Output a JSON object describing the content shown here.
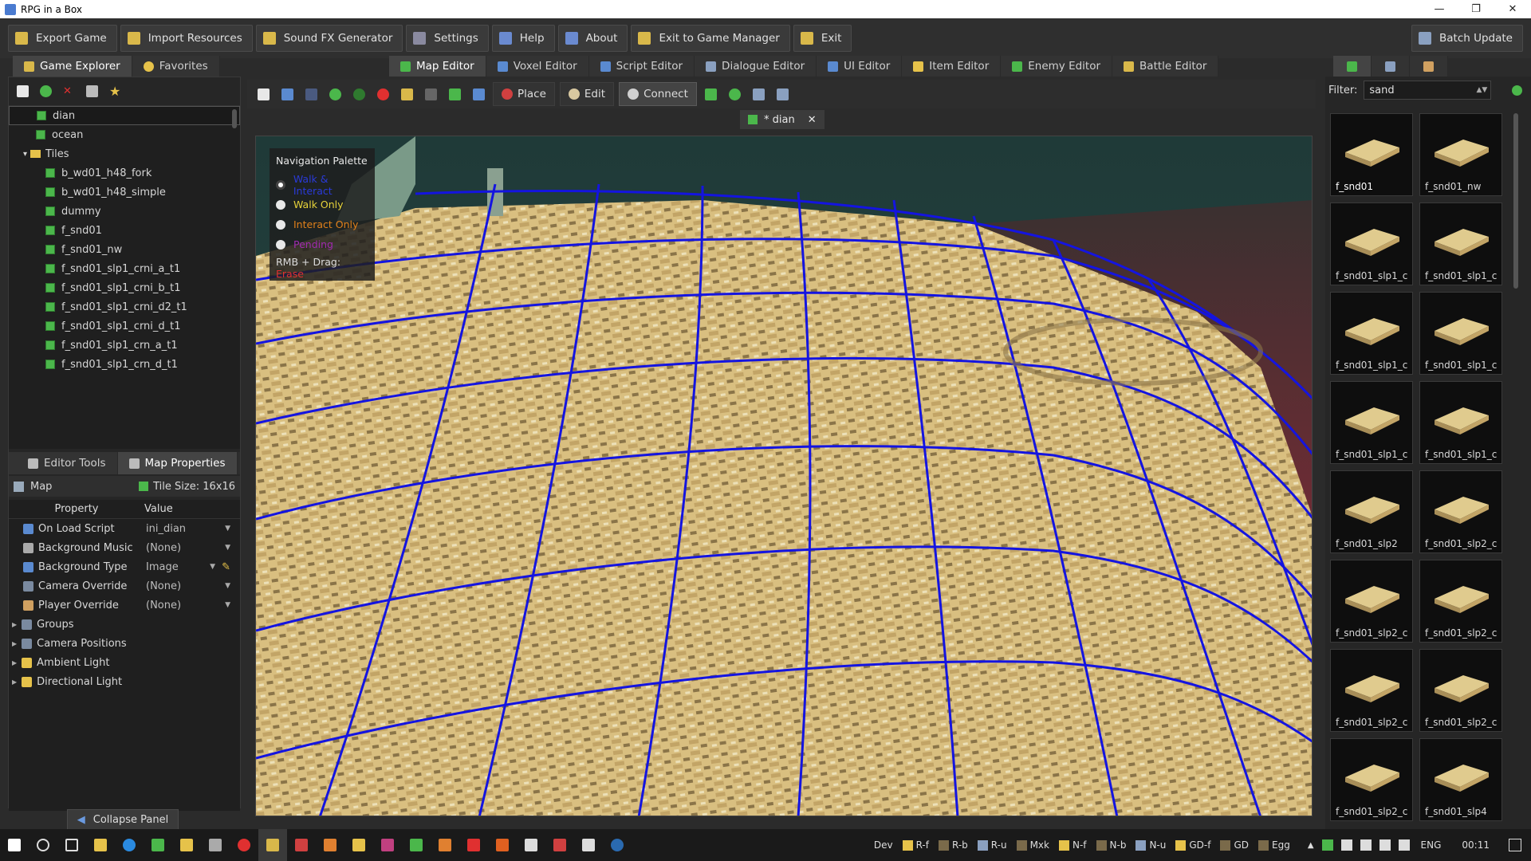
{
  "window": {
    "title": "RPG in a Box"
  },
  "menu": [
    {
      "label": "Export Game",
      "icon": "export-icon",
      "color": "#d9b84a"
    },
    {
      "label": "Import Resources",
      "icon": "import-icon",
      "color": "#d9b84a"
    },
    {
      "label": "Sound FX Generator",
      "icon": "sound-icon",
      "color": "#d9b84a"
    },
    {
      "label": "Settings",
      "icon": "settings-icon",
      "color": "#8a8aa0"
    },
    {
      "label": "Help",
      "icon": "help-icon",
      "color": "#6a8ad0"
    },
    {
      "label": "About",
      "icon": "about-icon",
      "color": "#6a8ad0"
    },
    {
      "label": "Exit to Game Manager",
      "icon": "game-manager-icon",
      "color": "#d9b84a"
    },
    {
      "label": "Exit",
      "icon": "exit-icon",
      "color": "#d9b84a"
    }
  ],
  "batch_update": "Batch Update",
  "left_tabs": [
    "Game Explorer",
    "Favorites"
  ],
  "editor_tabs": [
    "Map Editor",
    "Voxel Editor",
    "Script Editor",
    "Dialogue Editor",
    "UI Editor",
    "Item Editor",
    "Enemy Editor",
    "Battle Editor"
  ],
  "tree": {
    "items": [
      {
        "label": "dian",
        "indent": 34,
        "selected": true
      },
      {
        "label": "ocean",
        "indent": 34
      },
      {
        "label": "Tiles",
        "indent": 18,
        "folder": true
      },
      {
        "label": "b_wd01_h48_fork",
        "indent": 46
      },
      {
        "label": "b_wd01_h48_simple",
        "indent": 46
      },
      {
        "label": "dummy",
        "indent": 46
      },
      {
        "label": "f_snd01",
        "indent": 46
      },
      {
        "label": "f_snd01_nw",
        "indent": 46
      },
      {
        "label": "f_snd01_slp1_crni_a_t1",
        "indent": 46
      },
      {
        "label": "f_snd01_slp1_crni_b_t1",
        "indent": 46
      },
      {
        "label": "f_snd01_slp1_crni_d2_t1",
        "indent": 46
      },
      {
        "label": "f_snd01_slp1_crni_d_t1",
        "indent": 46
      },
      {
        "label": "f_snd01_slp1_crn_a_t1",
        "indent": 46
      },
      {
        "label": "f_snd01_slp1_crn_d_t1",
        "indent": 46
      }
    ]
  },
  "panel_tabs": [
    "Editor Tools",
    "Map Properties"
  ],
  "map_header": {
    "label": "Map",
    "tile_size": "Tile Size: 16x16"
  },
  "props": {
    "col_property": "Property",
    "col_value": "Value",
    "rows": [
      {
        "name": "On Load Script",
        "value": "ini_dian",
        "icon": "#5a8ad0",
        "dropdown": true
      },
      {
        "name": "Background Music",
        "value": "(None)",
        "icon": "#aaaaaa",
        "dropdown": true
      },
      {
        "name": "Background Type",
        "value": "Image",
        "icon": "#5a8ad0",
        "dropdown": true,
        "edit": true
      },
      {
        "name": "Camera Override",
        "value": "(None)",
        "icon": "#7a8aa0",
        "dropdown": true
      },
      {
        "name": "Player Override",
        "value": "(None)",
        "icon": "#d0a060",
        "dropdown": true
      },
      {
        "name": "Groups",
        "value": "",
        "icon": "#7a8aa0",
        "expand": true
      },
      {
        "name": "Camera Positions",
        "value": "",
        "icon": "#7a8aa0",
        "expand": true
      },
      {
        "name": "Ambient Light",
        "value": "",
        "icon": "#e6c24a",
        "expand": true
      },
      {
        "name": "Directional Light",
        "value": "",
        "icon": "#e6c24a",
        "expand": true
      }
    ]
  },
  "collapse_panel": "Collapse Panel",
  "toolbar": {
    "place": "Place",
    "edit": "Edit",
    "connect": "Connect"
  },
  "map_tab": {
    "label": "* dian"
  },
  "nav_palette": {
    "title": "Navigation Palette",
    "options": [
      {
        "label": "Walk & Interact",
        "color": "#2a3ad8",
        "selected": true
      },
      {
        "label": "Walk Only",
        "color": "#e6d23a"
      },
      {
        "label": "Interact Only",
        "color": "#e0801a"
      },
      {
        "label": "Pending",
        "color": "#a02ab0"
      }
    ],
    "rmb": "RMB + Drag:",
    "erase": "Erase"
  },
  "filter": {
    "label": "Filter:",
    "value": "sand"
  },
  "tiles": [
    "f_snd01",
    "f_snd01_nw",
    "f_snd01_slp1_c",
    "f_snd01_slp1_c",
    "f_snd01_slp1_c",
    "f_snd01_slp1_c",
    "f_snd01_slp1_c",
    "f_snd01_slp1_c",
    "f_snd01_slp2",
    "f_snd01_slp2_c",
    "f_snd01_slp2_c",
    "f_snd01_slp2_c",
    "f_snd01_slp2_c",
    "f_snd01_slp2_c",
    "f_snd01_slp2_c",
    "f_snd01_slp4"
  ],
  "taskbar": {
    "items": [
      {
        "label": "Dev",
        "color": ""
      },
      {
        "label": "R-f",
        "color": "#e6c24a"
      },
      {
        "label": "R-b",
        "color": "#7a6a4a"
      },
      {
        "label": "R-u",
        "color": "#8aa0c0"
      },
      {
        "label": "Mxk",
        "color": "#7a6a4a"
      },
      {
        "label": "N-f",
        "color": "#e6c24a"
      },
      {
        "label": "N-b",
        "color": "#7a6a4a"
      },
      {
        "label": "N-u",
        "color": "#8aa0c0"
      },
      {
        "label": "GD-f",
        "color": "#e6c24a"
      },
      {
        "label": "GD",
        "color": "#7a6a4a"
      },
      {
        "label": "Egg",
        "color": "#7a6a4a"
      }
    ],
    "lang": "ENG",
    "time": "00:11"
  }
}
